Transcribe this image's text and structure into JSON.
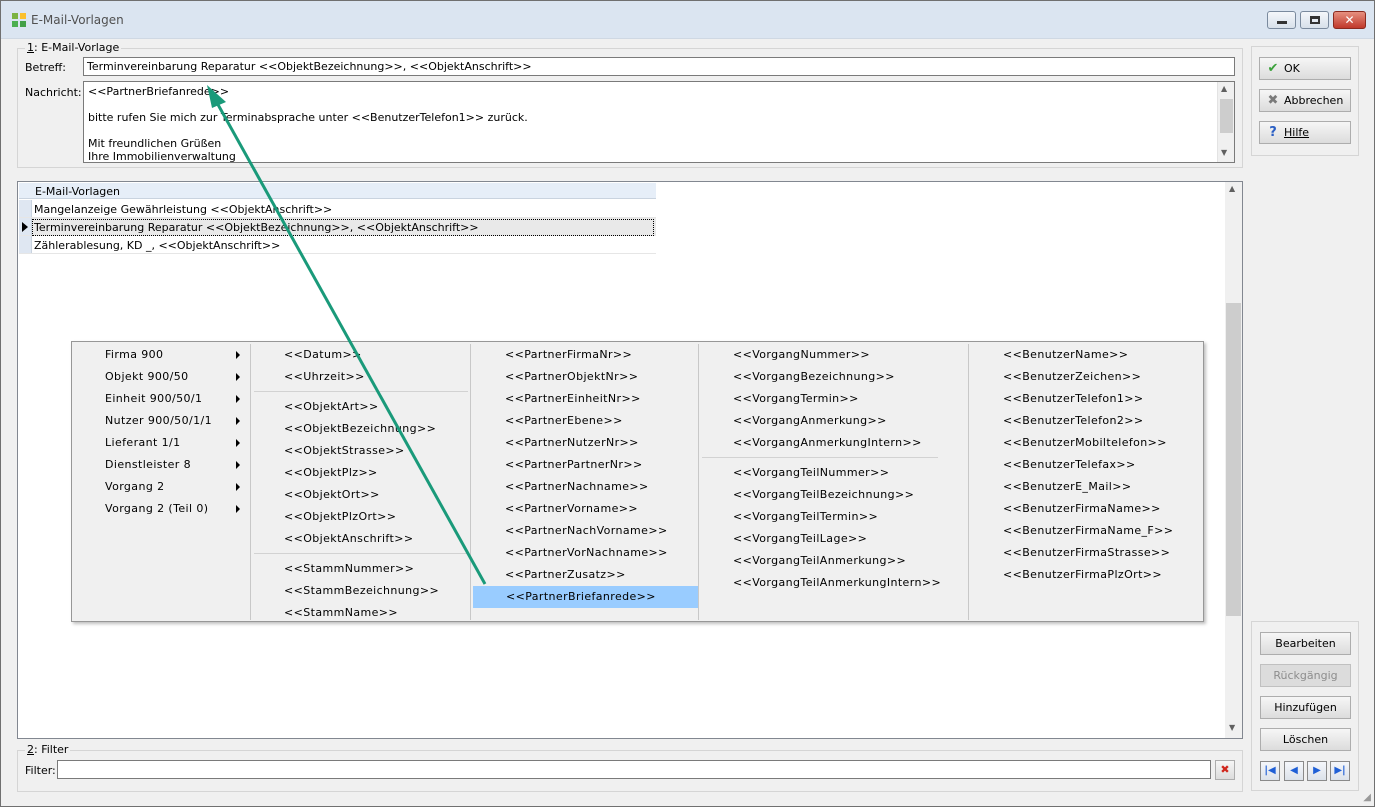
{
  "window": {
    "title": "E-Mail-Vorlagen"
  },
  "group1": {
    "title_prefix": "1",
    "title_rest": ": E-Mail-Vorlage",
    "betreff_label": "Betreff:",
    "betreff_value": "Terminvereinbarung Reparatur <<ObjektBezeichnung>>, <<ObjektAnschrift>>",
    "nachricht_label": "Nachricht:",
    "nachricht_value": "<<PartnerBriefanrede>>\n\nbitte rufen Sie mich zur Terminabsprache unter <<BenutzerTelefon1>> zurück.\n\nMit freundlichen Grüßen\nIhre Immobilienverwaltung"
  },
  "buttons": {
    "ok": "OK",
    "cancel": "Abbrechen",
    "help": "Hilfe",
    "edit": "Bearbeiten",
    "undo": "Rückgängig",
    "add": "Hinzufügen",
    "delete": "Löschen"
  },
  "grid": {
    "header": "E-Mail-Vorlagen",
    "rows": [
      "Mangelanzeige Gewährleistung <<ObjektAnschrift>>",
      "Terminvereinbarung Reparatur <<ObjektBezeichnung>>, <<ObjektAnschrift>>",
      "Zählerablesung, KD _, <<ObjektAnschrift>>"
    ],
    "selected_row": 2
  },
  "context_menu": {
    "categories": [
      "Firma 900",
      "Objekt 900/50",
      "Einheit 900/50/1",
      "Nutzer 900/50/1/1",
      "Lieferant 1/1",
      "Dienstleister 8",
      "Vorgang 2",
      "Vorgang 2 (Teil 0)"
    ],
    "col2_a": [
      "<<Datum>>",
      "<<Uhrzeit>>"
    ],
    "col2_b": [
      "<<ObjektArt>>",
      "<<ObjektBezeichnung>>",
      "<<ObjektStrasse>>",
      "<<ObjektPlz>>",
      "<<ObjektOrt>>",
      "<<ObjektPlzOrt>>",
      "<<ObjektAnschrift>>"
    ],
    "col2_c": [
      "<<StammNummer>>",
      "<<StammBezeichnung>>",
      "<<StammName>>"
    ],
    "col3": [
      "<<PartnerFirmaNr>>",
      "<<PartnerObjektNr>>",
      "<<PartnerEinheitNr>>",
      "<<PartnerEbene>>",
      "<<PartnerNutzerNr>>",
      "<<PartnerPartnerNr>>",
      "<<PartnerNachname>>",
      "<<PartnerVorname>>",
      "<<PartnerNachVorname>>",
      "<<PartnerVorNachname>>",
      "<<PartnerZusatz>>",
      "<<PartnerBriefanrede>>"
    ],
    "col3_highlighted": "<<PartnerBriefanrede>>",
    "col4_a": [
      "<<VorgangNummer>>",
      "<<VorgangBezeichnung>>",
      "<<VorgangTermin>>",
      "<<VorgangAnmerkung>>",
      "<<VorgangAnmerkungIntern>>"
    ],
    "col4_b": [
      "<<VorgangTeilNummer>>",
      "<<VorgangTeilBezeichnung>>",
      "<<VorgangTeilTermin>>",
      "<<VorgangTeilLage>>",
      "<<VorgangTeilAnmerkung>>",
      "<<VorgangTeilAnmerkungIntern>>"
    ],
    "col5": [
      "<<BenutzerName>>",
      "<<BenutzerZeichen>>",
      "<<BenutzerTelefon1>>",
      "<<BenutzerTelefon2>>",
      "<<BenutzerMobiltelefon>>",
      "<<BenutzerTelefax>>",
      "<<BenutzerE_Mail>>",
      "<<BenutzerFirmaName>>",
      "<<BenutzerFirmaName_F>>",
      "<<BenutzerFirmaStrasse>>",
      "<<BenutzerFirmaPlzOrt>>"
    ]
  },
  "group2": {
    "title_prefix": "2",
    "title_rest": ": Filter",
    "filter_label": "Filter:",
    "filter_value": ""
  },
  "colors": {
    "highlight": "#99ccff",
    "annotation_arrow": "#1a9a7a",
    "titlebar": "#dbe5f1"
  },
  "icons": {
    "ok": "check-icon",
    "cancel": "x-icon",
    "help": "question-icon",
    "nav": [
      "first-icon",
      "prev-icon",
      "next-icon",
      "last-icon"
    ]
  }
}
